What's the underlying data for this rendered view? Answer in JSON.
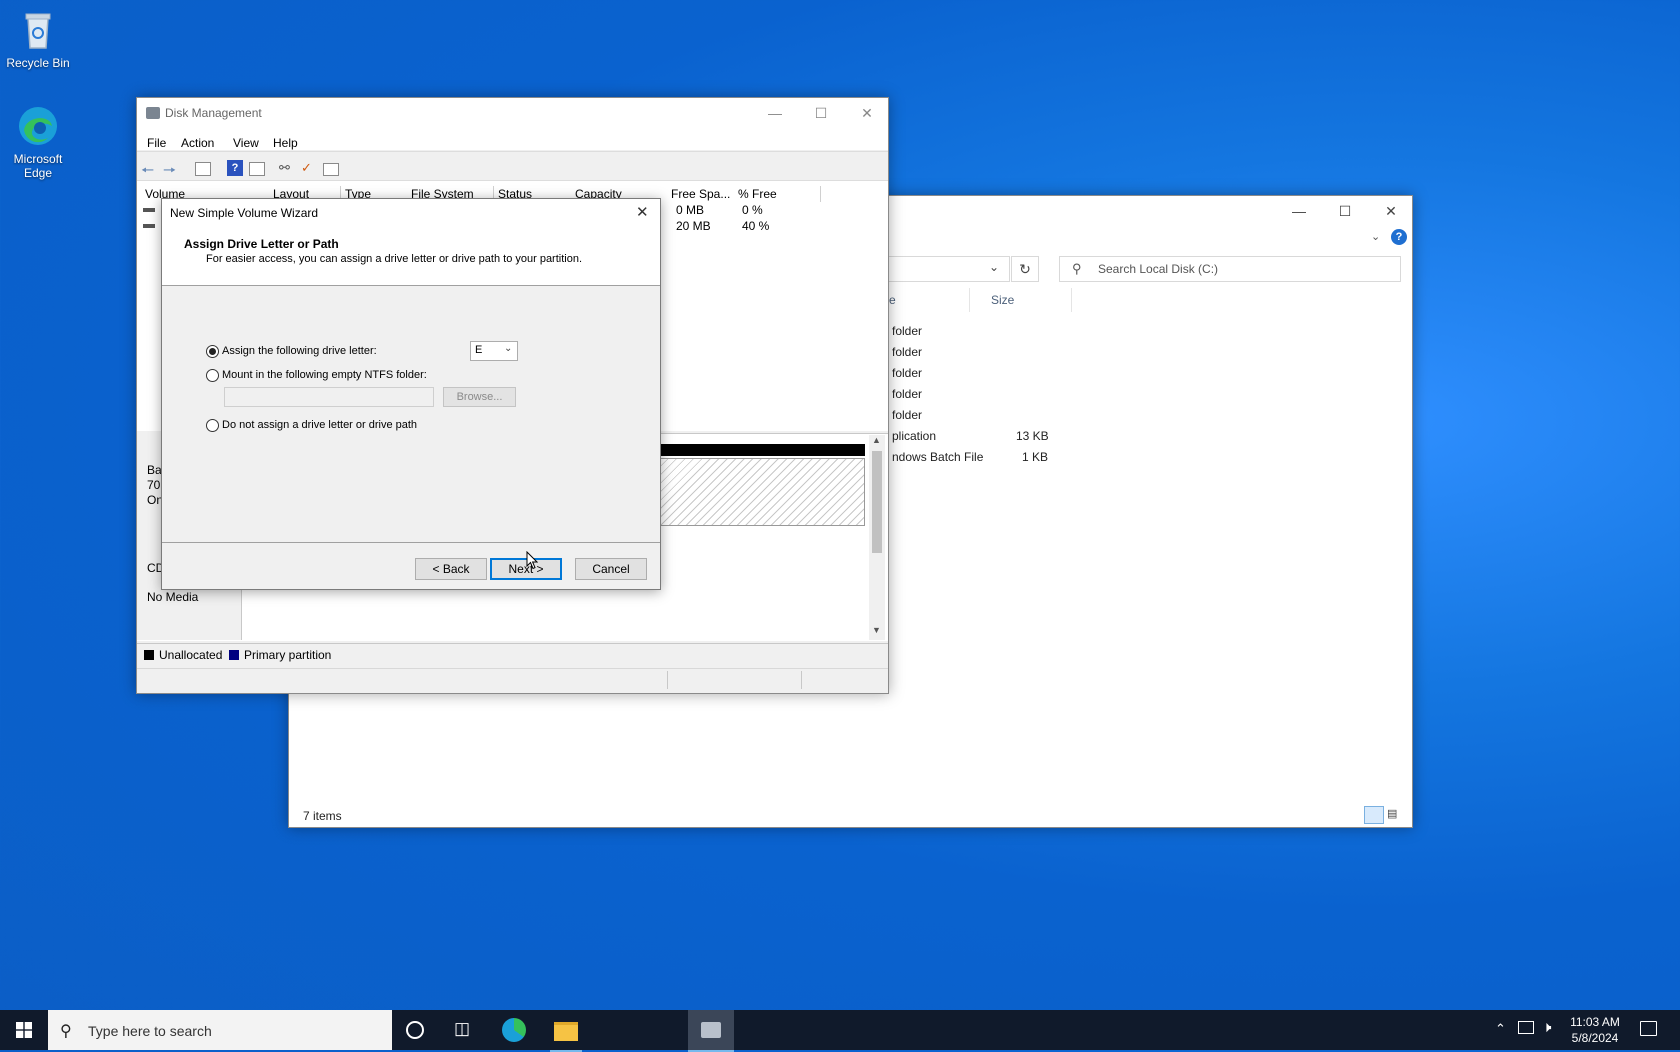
{
  "desktop": {
    "icons": [
      {
        "label": "Recycle Bin",
        "icon": "recycle-bin-icon"
      },
      {
        "label": "Microsoft Edge",
        "icon": "edge-icon"
      }
    ]
  },
  "explorer": {
    "search_placeholder": "Search Local Disk (C:)",
    "col_size": "Size",
    "rows": [
      {
        "type": "folder",
        "size": ""
      },
      {
        "type": "folder",
        "size": ""
      },
      {
        "type": "folder",
        "size": ""
      },
      {
        "type": "folder",
        "size": ""
      },
      {
        "type": "folder",
        "size": ""
      },
      {
        "type": "plication",
        "size": "13 KB"
      },
      {
        "type": "ndows Batch File",
        "size": "1 KB"
      }
    ],
    "status": "7 items"
  },
  "disk_mgmt": {
    "title": "Disk Management",
    "menu": [
      "File",
      "Action",
      "View",
      "Help"
    ],
    "columns": [
      "Volume",
      "Layout",
      "Type",
      "File System",
      "Status",
      "Capacity",
      "Free Spa...",
      "% Free"
    ],
    "volume_rows": [
      {
        "free": "0 MB",
        "pct": "0 %"
      },
      {
        "free": "20 MB",
        "pct": "40 %"
      }
    ],
    "lower_left": [
      "Ba",
      "70.",
      "On",
      "CD",
      "No Media"
    ],
    "legend": [
      "Unallocated",
      "Primary partition"
    ],
    "legend_colors": {
      "unallocated": "#000000",
      "primary": "#000080"
    }
  },
  "wizard": {
    "title": "New Simple Volume Wizard",
    "heading": "Assign Drive Letter or Path",
    "subheading": "For easier access, you can assign a drive letter or drive path to your partition.",
    "option_assign": "Assign the following drive letter:",
    "drive_letter": "E",
    "option_mount": "Mount in the following empty NTFS folder:",
    "browse_label": "Browse...",
    "option_none": "Do not assign a drive letter or drive path",
    "back_label": "< Back",
    "next_label": "Next >",
    "cancel_label": "Cancel"
  },
  "taskbar": {
    "search_placeholder": "Type here to search",
    "time": "11:03 AM",
    "date": "5/8/2024"
  }
}
